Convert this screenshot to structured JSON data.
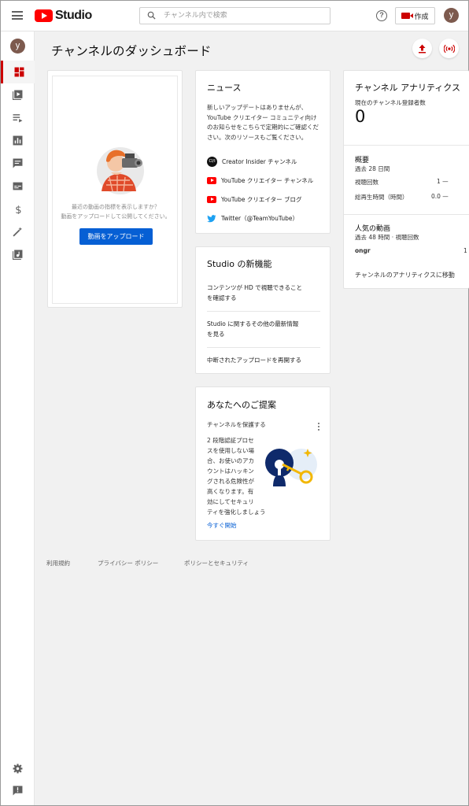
{
  "header": {
    "logo_text": "Studio",
    "search_placeholder": "チャンネル内で検索",
    "create_label": "作成",
    "avatar_letter": "y"
  },
  "sidebar": {
    "avatar_letter": "y",
    "items": [
      {
        "icon": "dashboard-icon",
        "active": true
      },
      {
        "icon": "videos-icon"
      },
      {
        "icon": "playlists-icon"
      },
      {
        "icon": "analytics-icon"
      },
      {
        "icon": "comments-icon"
      },
      {
        "icon": "subtitles-icon"
      },
      {
        "icon": "monetization-icon"
      },
      {
        "icon": "customization-icon"
      },
      {
        "icon": "audio-library-icon"
      }
    ],
    "bottom": [
      "settings-icon",
      "feedback-icon"
    ]
  },
  "main": {
    "title": "チャンネルのダッシュボード"
  },
  "upload_card": {
    "prompt_line1": "最近の動画の指標を表示しますか？",
    "prompt_line2": "動画をアップロードして公開してください。",
    "button": "動画をアップロード"
  },
  "news_card": {
    "title": "ニュース",
    "body": [
      "新しいアップデートはありませんが、",
      "YouTube クリエイター コミュニティ向け",
      "のお知らせをこちらで定期的にご確認くだ",
      "さい。次のリソースもご覧ください。"
    ],
    "links": [
      {
        "icon": "creator-insider-icon",
        "label": "Creator Insider チャンネル"
      },
      {
        "icon": "youtube-icon",
        "label": "YouTube クリエイター チャンネル"
      },
      {
        "icon": "youtube-icon",
        "label": "YouTube クリエイター ブログ"
      },
      {
        "icon": "twitter-icon",
        "label": "Twitter（@TeamYouTube）"
      }
    ],
    "ci_text": "CI/I"
  },
  "studio_card": {
    "title": "Studio の新機能",
    "items": [
      {
        "line1": "コンテンツが HD で視聴できること",
        "line2": "を確認する"
      },
      {
        "line1": "Studio に関するその他の最新情報",
        "line2": "を見る"
      },
      {
        "line1": "中断されたアップロードを再開する",
        "line2": ""
      }
    ]
  },
  "suggest_card": {
    "title": "あなたへのご提案",
    "subtitle": "チャンネルを保護する",
    "body": [
      "2 段階認証プロセ",
      "スを使用しない場",
      "合、お使いのアカ",
      "ウントはハッキン",
      "グされる危険性が",
      "高くなります。有",
      "効にしてセキュリ",
      "ティを強化しましょう"
    ],
    "cta": "今すぐ開始"
  },
  "analytics_card": {
    "title": "チャンネル アナリティクス",
    "subs_label": "現在のチャンネル登録者数",
    "subs_value": "0",
    "summary_title": "概要",
    "summary_period": "過去 28 日間",
    "views_label": "視聴回数",
    "views_value": "1 —",
    "watch_label": "総再生時間（時間）",
    "watch_value": "0.0 —",
    "top_title": "人気の動画",
    "top_period": "過去 48 時間 · 視聴回数",
    "top_video_name": "ongr",
    "top_video_views": "1",
    "link": "チャンネルのアナリティクスに移動"
  },
  "footer": {
    "terms": "利用規約",
    "privacy": "プライバシー ポリシー",
    "policy": "ポリシーとセキュリティ"
  }
}
